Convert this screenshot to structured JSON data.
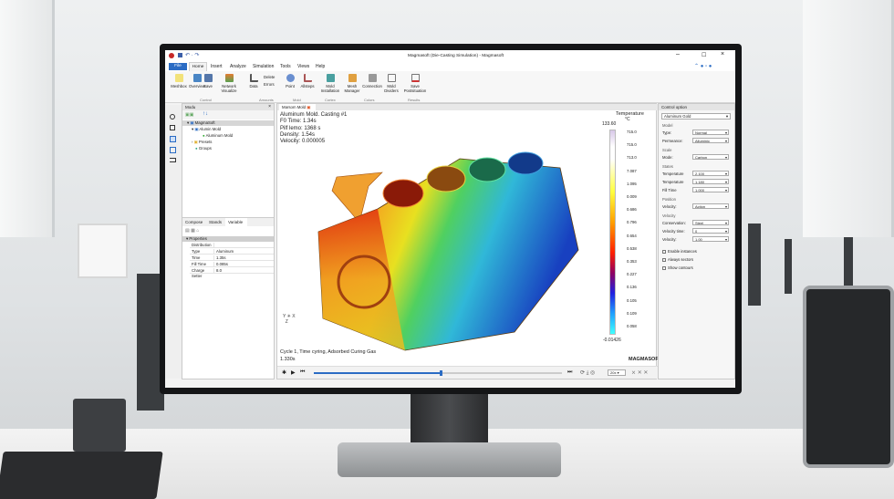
{
  "window": {
    "title": "Magmasoft (Die-Casting Simulation) - Magmasoft"
  },
  "ribbon": {
    "tabs": [
      "File",
      "Home",
      "Insert",
      "Analyze",
      "Simulation",
      "Tools",
      "Views",
      "Help"
    ],
    "buttons": [
      {
        "label": "Meshbox",
        "group": "Control"
      },
      {
        "label": "Overview",
        "group": "Control"
      },
      {
        "label": "Save",
        "group": "Control"
      },
      {
        "label": "Network Visualize",
        "group": "Control"
      },
      {
        "label": "Data",
        "group": "Amounts"
      },
      {
        "label": "Delete",
        "group": "Amounts"
      },
      {
        "label": "Errors",
        "group": "Amounts"
      },
      {
        "label": "Point",
        "group": "Mold"
      },
      {
        "label": "Allsteps",
        "group": "Mold"
      },
      {
        "label": "Mold Installation",
        "group": "Cortex"
      },
      {
        "label": "Mesh Manager",
        "group": "Colors"
      },
      {
        "label": "Connection",
        "group": "Colors"
      },
      {
        "label": "Mold Dividers",
        "group": "Colors"
      },
      {
        "label": "Save Postsituation",
        "group": "Results"
      }
    ],
    "groups": [
      "Control",
      "Amounts",
      "Mold",
      "Cortex",
      "Colors",
      "Results"
    ]
  },
  "left_panel": {
    "title": "Modu",
    "tree": [
      "MagmaSoft",
      "Alumin Mold",
      "Aluminum Mold",
      "Presets",
      "Groups"
    ],
    "tabs": [
      "Compose",
      "Stands",
      "Variable"
    ],
    "props_header": "Properties",
    "props": [
      [
        "Distribution",
        ""
      ],
      [
        "Type",
        "Aluminum"
      ],
      [
        "Time",
        "1.35s"
      ],
      [
        "Fill Time",
        "0.085s"
      ],
      [
        "Charge Setter",
        "8.0"
      ]
    ]
  },
  "viewport": {
    "tab": "Marsom Mold",
    "info": [
      "Aluminum Mold. Casting #1",
      "F0 Time: 1.34s",
      "Pilf lemo: 1368 s",
      "Density: 1.54s",
      "Velocity: 0.000005"
    ],
    "caption": "Cycle 1, Time cyring, Adsorbed Curing Gas",
    "time": "1.330s",
    "legend": {
      "title": "Temperature",
      "unit": "°C",
      "max": "133.60",
      "ticks": [
        "715.0",
        "715.0",
        "713.0",
        "7.087",
        "1.095",
        "0.009",
        "0.686",
        "0.796",
        "0.654",
        "0.538",
        "0.353",
        "0.227",
        "0.136",
        "0.105",
        "0.109",
        "0.058"
      ],
      "min": "-0.01426"
    },
    "brand": "MAGMASOFT",
    "playback": {
      "progress": 0.51,
      "speed": "20x"
    }
  },
  "right_panel": {
    "title": "Control option",
    "preset": "Aluminum Gold",
    "sections": [
      {
        "title": "Model",
        "fields": [
          [
            "Type:",
            "Normal"
          ],
          [
            "Permeance:",
            "Alluminic"
          ]
        ]
      },
      {
        "title": "Scale",
        "fields": [
          [
            "Mode:",
            "Carbon"
          ]
        ]
      },
      {
        "title": "States",
        "fields": [
          [
            "Temperature",
            "2.100"
          ],
          [
            "Temperature",
            "1.180"
          ],
          [
            "Fill Time",
            "1.000"
          ]
        ]
      },
      {
        "title": "Position",
        "fields": [
          [
            "Velocity:",
            "Action"
          ]
        ]
      },
      {
        "title": "Velocity",
        "fields": [
          [
            "Conservation:",
            "Steel"
          ],
          [
            "Velocity time:",
            "0"
          ],
          [
            "Velocity:",
            "1.00"
          ]
        ]
      }
    ],
    "checkboxes": [
      "Enable instances",
      "Always sectors",
      "Show contours"
    ]
  }
}
